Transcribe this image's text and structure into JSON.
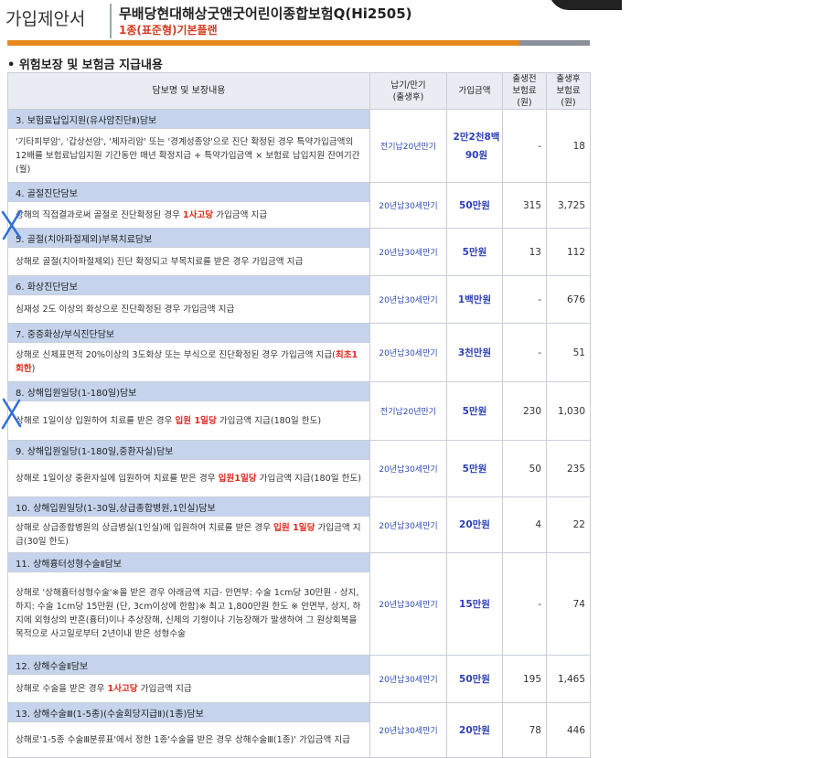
{
  "header": {
    "doc_label": "가입제안서",
    "product_name": "무배당현대해상굿앤굿어린이종합보험Q(Hi2505)",
    "plan_name": "1종(표준형)기본플랜"
  },
  "section_title": "• 위험보장 및 보험금 지급내용",
  "table_headers": {
    "name": "담보명 및 보장내용",
    "period": "납기/만기\n(출생후)",
    "amount": "가입금액",
    "prebirth": "출생전\n보험료(원)",
    "postbirth": "출생후\n보험료(원)"
  },
  "rows": [
    {
      "title": "3.  보험료납입지원(유사암진단Ⅱ)담보",
      "desc": [
        {
          "t": "'기타피부암', '갑상선암', '제자리암' 또는 '경계성종양'으로 진단 확정된 경우 특약가입금액의 12배를 보험료납입지원 기간동안 매년 확정지급 + 특약가입금액 × 보험료 납입지원 잔여기간(월)"
        }
      ],
      "period": "전기납20년만기",
      "amount": "2만2천8백90원",
      "prebirth": "-",
      "postbirth": "18"
    },
    {
      "title": "4.  골절진단담보",
      "desc": [
        {
          "t": "상해의 직접결과로써 골절로 진단확정된 경우 "
        },
        {
          "t": "1사고당",
          "red": true
        },
        {
          "t": " 가입금액 지급"
        }
      ],
      "period": "20년납30세만기",
      "amount": "50만원",
      "prebirth": "315",
      "postbirth": "3,725"
    },
    {
      "title": "5.  골절(치아파절제외)부목치료담보",
      "desc": [
        {
          "t": "상해로 골절(치아파절제외) 진단 확정되고 부목치료를 받은 경우 가입금액 지급"
        }
      ],
      "period": "20년납30세만기",
      "amount": "5만원",
      "prebirth": "13",
      "postbirth": "112"
    },
    {
      "title": "6.  화상진단담보",
      "desc": [
        {
          "t": "심재성 2도 이상의 화상으로 진단확정된 경우 가입금액 지급"
        }
      ],
      "period": "20년납30세만기",
      "amount": "1백만원",
      "prebirth": "-",
      "postbirth": "676"
    },
    {
      "title": "7.  중증화상/부식진단담보",
      "desc": [
        {
          "t": "상해로 신체표면적 20%이상의 3도화상 또는 부식으로 진단확정된 경우 가입금액 지급("
        },
        {
          "t": "최초1회한",
          "red": true
        },
        {
          "t": ")"
        }
      ],
      "period": "20년납30세만기",
      "amount": "3천만원",
      "prebirth": "-",
      "postbirth": "51"
    },
    {
      "title": "8.  상해입원일당(1-180일)담보",
      "desc": [
        {
          "t": "상해로 1일이상 입원하여 치료를 받은 경우 "
        },
        {
          "t": "입원 1일당",
          "red": true
        },
        {
          "t": " 가입금액 지급(180일 한도)"
        }
      ],
      "period": "전기납20년만기",
      "amount": "5만원",
      "prebirth": "230",
      "postbirth": "1,030"
    },
    {
      "title": "9.  상해입원일당(1-180일,중환자실)담보",
      "desc": [
        {
          "t": "상해로 1일이상 중환자실에 입원하여 치료를 받은 경우 "
        },
        {
          "t": "입원1일당",
          "red": true
        },
        {
          "t": " 가입금액 지급(180일 한도)"
        }
      ],
      "period": "20년납30세만기",
      "amount": "5만원",
      "prebirth": "50",
      "postbirth": "235"
    },
    {
      "title": "10. 상해입원일당(1-30일,상급종합병원,1인실)담보",
      "desc": [
        {
          "t": "상해로 상급종합병원의 상급병실(1인실)에 입원하여 치료를 받은 경우 "
        },
        {
          "t": "입원 1일당",
          "red": true
        },
        {
          "t": " 가입금액 지급(30일 한도)"
        }
      ],
      "period": "20년납30세만기",
      "amount": "20만원",
      "prebirth": "4",
      "postbirth": "22"
    },
    {
      "title": "11.  상해흉터성형수술Ⅱ담보",
      "desc": [
        {
          "t": "상해로 '상해흉터성형수술'※을 받은 경우 아래금액 지급- 안면부: 수술 1cm당 30만원 - 상지,하지: 수술 1cm당 15만원  (단, 3cm이상에 한함)※ 최고 1,800만원 한도 ※ 안면부, 상지, 하지에 외형상의 반흔(흉터)이나 추상장해, 신체의 기형이나 기능장해가 발생하여 그 원상회복을 목적으로 사고일로부터 2년이내 받은 성형수술"
        }
      ],
      "period": "20년납30세만기",
      "amount": "15만원",
      "prebirth": "-",
      "postbirth": "74"
    },
    {
      "title": "12.  상해수술Ⅱ담보",
      "desc": [
        {
          "t": "상해로 수술을 받은 경우 "
        },
        {
          "t": "1사고당",
          "red": true
        },
        {
          "t": " 가입금액 지급"
        }
      ],
      "period": "20년납30세만기",
      "amount": "50만원",
      "prebirth": "195",
      "postbirth": "1,465"
    },
    {
      "title": "13.  상해수술Ⅲ(1-5종)(수술회당지급Ⅱ)(1종)담보",
      "desc": [
        {
          "t": "상해로'1-5종 수술Ⅲ분류표'에서 정한 1종'수술을 받은 경우 상해수술Ⅲ(1종)' 가입금액 지급"
        }
      ],
      "period": "20년납30세만기",
      "amount": "20만원",
      "prebirth": "78",
      "postbirth": "446"
    }
  ]
}
